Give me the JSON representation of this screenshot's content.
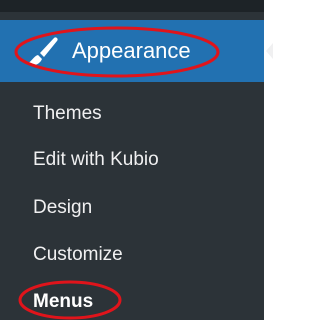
{
  "menu": {
    "active_item": {
      "label": "Appearance",
      "icon": "paintbrush-icon"
    },
    "submenu": [
      {
        "label": "Themes"
      },
      {
        "label": "Edit with Kubio"
      },
      {
        "label": "Design"
      },
      {
        "label": "Customize"
      },
      {
        "label": "Menus",
        "current": true
      }
    ]
  },
  "colors": {
    "sidebar_background": "#2c3338",
    "active_item_background": "#2231b1",
    "highlight_ring": "#e0141b",
    "text": "#ffffff"
  }
}
